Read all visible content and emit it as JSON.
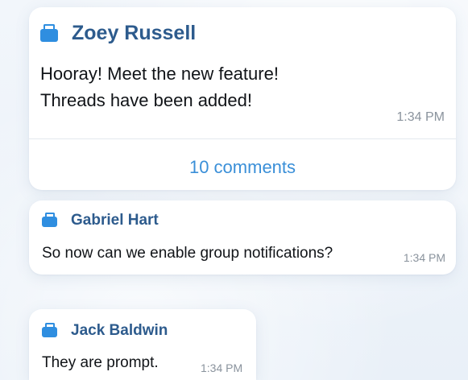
{
  "messages": [
    {
      "author": "Zoey Russell",
      "text_lines": [
        "Hooray! Meet the new feature!",
        "Threads have been added!"
      ],
      "time": "1:34 PM",
      "comments_label": "10 comments"
    },
    {
      "author": "Gabriel Hart",
      "text": "So now can we enable group notifications?",
      "time": "1:34 PM"
    },
    {
      "author": "Jack Baldwin",
      "text": "They are prompt.",
      "time": "1:34 PM"
    }
  ],
  "icons": {
    "author_badge": "briefcase-icon"
  },
  "colors": {
    "author": "#2d5b8d",
    "badge": "#2f8ee0",
    "link": "#3a8fd8",
    "time": "#8a939d",
    "background": "#eef3f9"
  }
}
